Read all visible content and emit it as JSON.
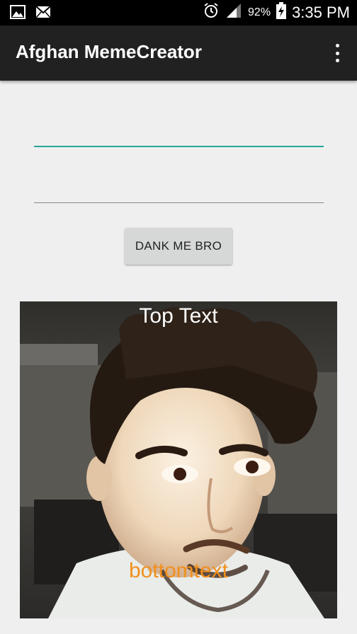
{
  "status_bar": {
    "icons": [
      "image-icon",
      "mail-icon",
      "alarm-icon",
      "signal-icon",
      "battery-charging-icon"
    ],
    "battery": "92%",
    "time": "3:35 PM"
  },
  "app_bar": {
    "title": "Afghan MemeCreator",
    "menu_icon": "overflow-menu-icon"
  },
  "form": {
    "top_text_value": "",
    "bottom_text_value": "",
    "button_label": "DANK ME BRO"
  },
  "meme": {
    "top_text": "Top Text",
    "bottom_text": "bottomtext",
    "top_text_color": "#ffffff",
    "bottom_text_color": "#f0901e"
  },
  "colors": {
    "status_bar": "#000000",
    "app_bar": "#212121",
    "background": "#efefef",
    "input_accent": "#26a69a",
    "button": "#d6d7d7"
  }
}
